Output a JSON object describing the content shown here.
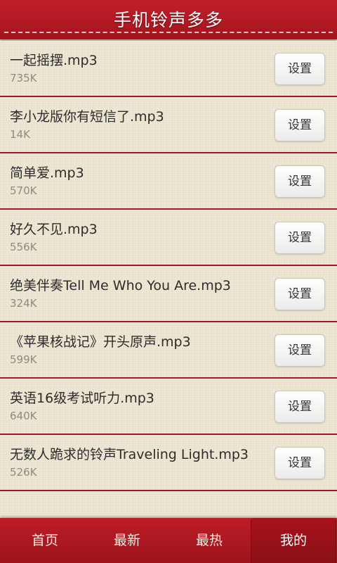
{
  "header": {
    "title": "手机铃声多多"
  },
  "ringtones": [
    {
      "name": "一起摇摆.mp3",
      "size": "735K",
      "action": "设置"
    },
    {
      "name": "李小龙版你有短信了.mp3",
      "size": "14K",
      "action": "设置"
    },
    {
      "name": "简单爱.mp3",
      "size": "570K",
      "action": "设置"
    },
    {
      "name": "好久不见.mp3",
      "size": "556K",
      "action": "设置"
    },
    {
      "name": "绝美伴奏Tell Me Who You Are.mp3",
      "size": "324K",
      "action": "设置"
    },
    {
      "name": "《苹果核战记》开头原声.mp3",
      "size": "599K",
      "action": "设置"
    },
    {
      "name": "英语16级考试听力.mp3",
      "size": "640K",
      "action": "设置"
    },
    {
      "name": "无数人跪求的铃声Traveling Light.mp3",
      "size": "526K",
      "action": "设置"
    }
  ],
  "tabs": [
    {
      "label": "首页"
    },
    {
      "label": "最新"
    },
    {
      "label": "最热"
    },
    {
      "label": "我的",
      "active": true
    }
  ],
  "colors": {
    "accent": "#b01a23",
    "background": "#efe6d3"
  }
}
